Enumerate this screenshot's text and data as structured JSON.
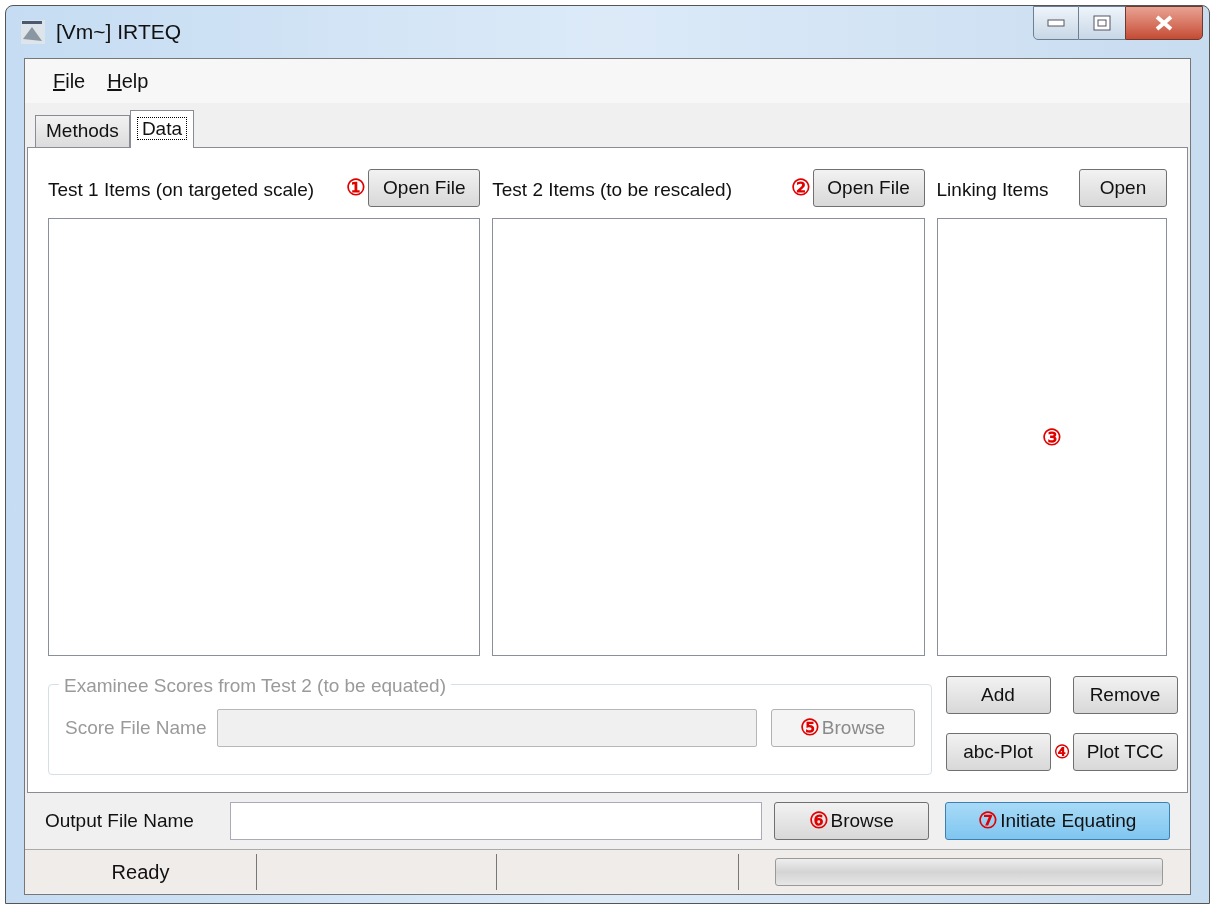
{
  "window": {
    "title": "[Vm~] IRTEQ"
  },
  "menu": [
    {
      "label": "File",
      "underlined": true
    },
    {
      "label": "Help",
      "underlined": true
    }
  ],
  "tabs": [
    {
      "label": "Methods",
      "selected": false
    },
    {
      "label": "Data",
      "selected": true
    }
  ],
  "lists": [
    {
      "label": "Test 1 Items (on targeted scale)",
      "marker": "①",
      "button": "Open File"
    },
    {
      "label": "Test 2 Items (to be rescaled)",
      "marker": "②",
      "button": "Open File"
    },
    {
      "label": "Linking Items",
      "button": "Open",
      "marker_inside": "③"
    }
  ],
  "score_group": {
    "title": "Examinee Scores from Test 2 (to be equated)",
    "disabled": true,
    "field_label": "Score File Name",
    "button": {
      "label": "Browse",
      "marker": "⑤"
    }
  },
  "linking_buttons": [
    {
      "label": "Add"
    },
    {
      "label": "Remove"
    },
    {
      "label": "abc-Plot"
    },
    {
      "label": "Plot TCC",
      "marker": "④"
    }
  ],
  "output": {
    "label": "Output File Name",
    "browse": {
      "label": "Browse",
      "marker": "⑥"
    },
    "initiate": {
      "label": "Initiate Equating",
      "marker": "⑦",
      "highlighted": true
    }
  },
  "status_bar": {
    "text": "Ready",
    "progress": {
      "level": 0
    }
  }
}
